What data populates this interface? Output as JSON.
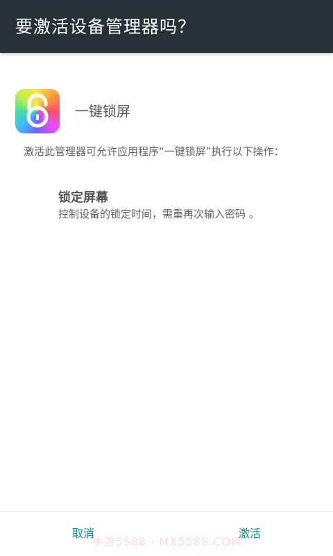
{
  "dialog": {
    "title": "要激活设备管理器吗？"
  },
  "app": {
    "name": "一键锁屏",
    "icon": "rainbow-padlock-icon"
  },
  "description": "激活此管理器可允许应用程序“一键锁屏”执行以下操作：",
  "policy": {
    "title": "锁定屏幕",
    "description": "控制设备的锁定时间，需重再次输入密码 。"
  },
  "buttons": {
    "cancel": "取消",
    "activate": "激活"
  },
  "watermark": "手游5588 · MX5588.COM",
  "colors": {
    "titlebar": "#263238",
    "accent": "#0f8f85"
  }
}
